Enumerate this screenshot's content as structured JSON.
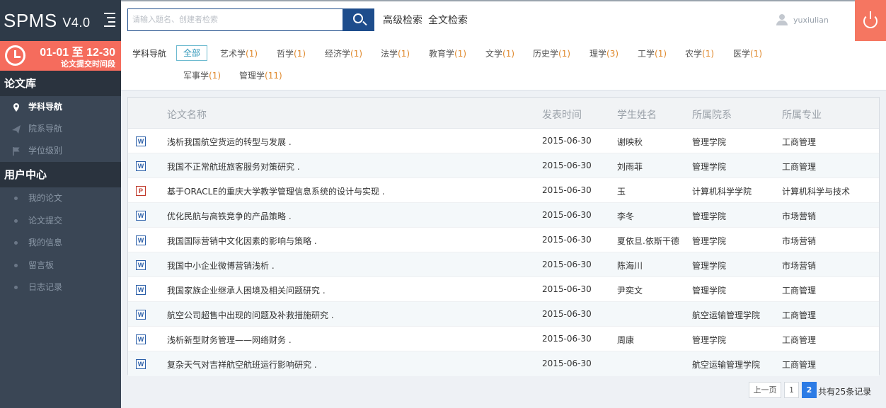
{
  "app": {
    "name": "SPMS",
    "version": "V4.0"
  },
  "period": {
    "range": "01-01 至 12-30",
    "label": "论文提交时间段"
  },
  "sidebar": {
    "sections": [
      {
        "title": "论文库",
        "items": [
          {
            "label": "学科导航",
            "icon": "map-pin-icon",
            "active": true
          },
          {
            "label": "院系导航",
            "icon": "paper-plane-icon",
            "active": false
          },
          {
            "label": "学位级别",
            "icon": "flag-icon",
            "active": false
          }
        ]
      },
      {
        "title": "用户中心",
        "items": [
          {
            "label": "我的论文"
          },
          {
            "label": "论文提交"
          },
          {
            "label": "我的信息"
          },
          {
            "label": "留言板"
          },
          {
            "label": "日志记录"
          }
        ]
      }
    ]
  },
  "header": {
    "search_placeholder": "请输入题名、创建者检索",
    "advanced_search": "高级检索",
    "fulltext_search": "全文检索",
    "username": "yuxiulian"
  },
  "filter": {
    "label": "学科导航",
    "all": "全部",
    "subjects": [
      {
        "name": "艺术学",
        "count": "(1)"
      },
      {
        "name": "哲学",
        "count": "(1)"
      },
      {
        "name": "经济学",
        "count": "(1)"
      },
      {
        "name": "法学",
        "count": "(1)"
      },
      {
        "name": "教育学",
        "count": "(1)"
      },
      {
        "name": "文学",
        "count": "(1)"
      },
      {
        "name": "历史学",
        "count": "(1)"
      },
      {
        "name": "理学",
        "count": "(3)"
      },
      {
        "name": "工学",
        "count": "(1)"
      },
      {
        "name": "农学",
        "count": "(1)"
      },
      {
        "name": "医学",
        "count": "(1)"
      },
      {
        "name": "军事学",
        "count": "(1)"
      },
      {
        "name": "管理学",
        "count": "(11)"
      }
    ]
  },
  "table": {
    "columns": [
      "论文名称",
      "发表时间",
      "学生姓名",
      "所属院系",
      "所属专业"
    ],
    "rows": [
      {
        "type": "W",
        "title": "浅析我国航空货运的转型与发展 .",
        "date": "2015-06-30",
        "student": "谢映秋",
        "dept": "管理学院",
        "major": "工商管理"
      },
      {
        "type": "W",
        "title": "我国不正常航班旅客服务对策研究 .",
        "date": "2015-06-30",
        "student": "刘雨菲",
        "dept": "管理学院",
        "major": "工商管理"
      },
      {
        "type": "P",
        "title": "基于ORACLE的重庆大学教学管理信息系统的设计与实现 .",
        "date": "2015-06-30",
        "student": "玉",
        "dept": "计算机科学学院",
        "major": "计算机科学与技术"
      },
      {
        "type": "W",
        "title": "优化民航与高铁竞争的产品策略 .",
        "date": "2015-06-30",
        "student": "李冬",
        "dept": "管理学院",
        "major": "市场营销"
      },
      {
        "type": "W",
        "title": "我国国际营销中文化因素的影响与策略 .",
        "date": "2015-06-30",
        "student": "夏依旦.依斯干德",
        "dept": "管理学院",
        "major": "市场营销"
      },
      {
        "type": "W",
        "title": "我国中小企业微博营销浅析 .",
        "date": "2015-06-30",
        "student": "陈海川",
        "dept": "管理学院",
        "major": "市场营销"
      },
      {
        "type": "W",
        "title": "我国家族企业继承人困境及相关问题研究 .",
        "date": "2015-06-30",
        "student": "尹奕文",
        "dept": "管理学院",
        "major": "工商管理"
      },
      {
        "type": "W",
        "title": "航空公司超售中出现的问题及补救措施研究 .",
        "date": "2015-06-30",
        "student": "",
        "dept": "航空运输管理学院",
        "major": "工商管理"
      },
      {
        "type": "W",
        "title": "浅析新型财务管理——网络财务 .",
        "date": "2015-06-30",
        "student": "周康",
        "dept": "管理学院",
        "major": "工商管理"
      },
      {
        "type": "W",
        "title": "复杂天气对吉祥航空航班运行影响研究 .",
        "date": "2015-06-30",
        "student": "",
        "dept": "航空运输管理学院",
        "major": "工商管理"
      }
    ]
  },
  "pagination": {
    "prev": "上一页",
    "pages": [
      "1",
      "2"
    ],
    "current": "2",
    "total": "共有25条记录"
  },
  "colors": {
    "sidebar": "#3a4655",
    "accent": "#f56c5d",
    "search_button": "#1e4d8c",
    "count": "#e08a2e",
    "active_page": "#2c7be5"
  }
}
